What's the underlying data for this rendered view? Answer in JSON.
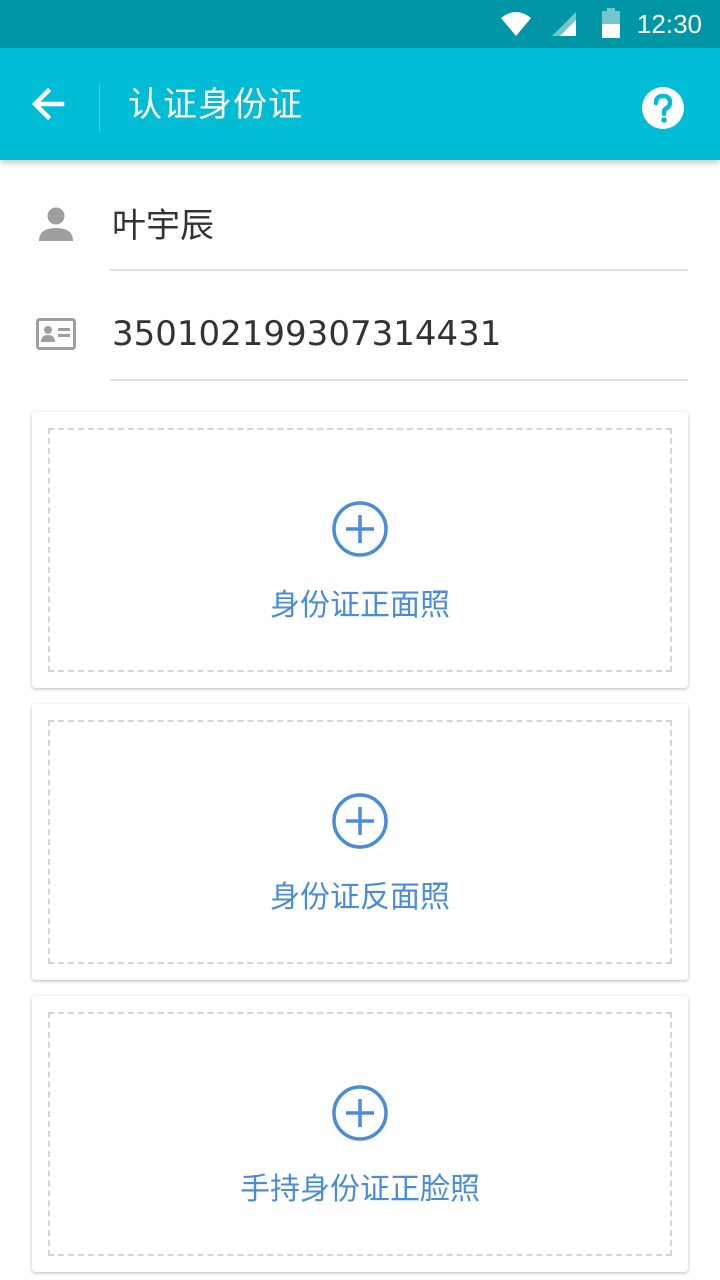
{
  "status_bar": {
    "time": "12:30",
    "icons": [
      "wifi-icon",
      "signal-icon",
      "battery-icon"
    ]
  },
  "app_bar": {
    "title": "认证身份证",
    "back_icon": "arrow-left-icon",
    "help_icon": "help-circle-icon"
  },
  "form": {
    "name_value": "叶宇辰",
    "name_icon": "person-icon",
    "id_value": "350102199307314431",
    "id_icon": "id-card-icon"
  },
  "uploads": [
    {
      "label": "身份证正面照",
      "icon": "add-circle-icon"
    },
    {
      "label": "身份证反面照",
      "icon": "add-circle-icon"
    },
    {
      "label": "手持身份证正脸照",
      "icon": "add-circle-icon"
    }
  ],
  "colors": {
    "status_bar": "#0096a6",
    "app_bar": "#00bcd4",
    "accent": "#4a8cd8",
    "icon_gray": "#9e9e9e"
  }
}
